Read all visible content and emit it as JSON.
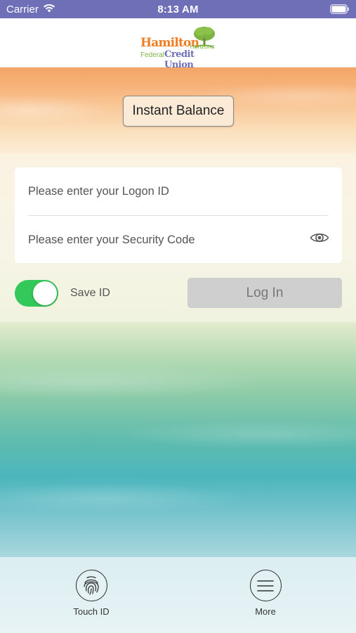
{
  "status_bar": {
    "carrier": "Carrier",
    "time": "8:13 AM"
  },
  "header": {
    "logo": {
      "line1": "Hamilton",
      "line2": "Horizons",
      "line3": "Federal",
      "line4": "Credit Union"
    }
  },
  "instant_balance": {
    "label": "Instant Balance"
  },
  "login": {
    "logon_placeholder": "Please enter your Logon ID",
    "security_placeholder": "Please enter your Security Code",
    "save_id_label": "Save ID",
    "save_id_on": true,
    "login_button": "Log In"
  },
  "tabbar": {
    "items": [
      {
        "label": "Touch ID",
        "icon": "fingerprint-icon"
      },
      {
        "label": "More",
        "icon": "menu-icon"
      }
    ]
  },
  "colors": {
    "status_bar": "#6f6fb7",
    "toggle_on": "#34c759",
    "brand_orange": "#f07d22",
    "brand_green": "#7cb342",
    "brand_purple": "#6f6fb7"
  }
}
